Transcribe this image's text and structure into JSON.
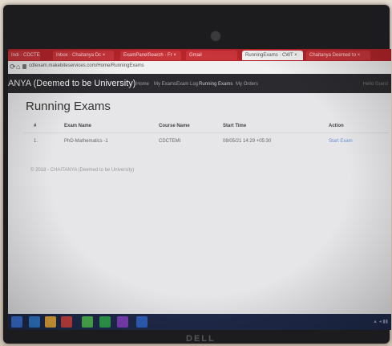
{
  "browser": {
    "tabs": [
      {
        "label": "Indi · CDCTEAM Ch ×"
      },
      {
        "label": "Inbox · Chaitanya Dc ×"
      },
      {
        "label": "ExamPanelSearch · Fr ×"
      },
      {
        "label": "Gmail"
      },
      {
        "label": "RunningExams · CWT ×",
        "active": true
      },
      {
        "label": "Chaitanya Deemed to ×"
      }
    ],
    "url": "cdtexam.makebiteservices.com/Home/RunningExams"
  },
  "site": {
    "title": "ANYA (Deemed to be University)",
    "nav": [
      "Home",
      "My Exams",
      "Exam Log",
      "Running Exams",
      "My Orders"
    ],
    "nav_right": "Hello Guest"
  },
  "page": {
    "title": "Running Exams",
    "table": {
      "headers": [
        "#",
        "Exam Name",
        "Course Name",
        "Start Time",
        "Action"
      ],
      "rows": [
        {
          "num": "1.",
          "exam": "PhD-Mathematics -1",
          "course": "CDCTEMI",
          "start": "08/05/21 14:29 +05:30",
          "action": "Start Exam"
        }
      ]
    },
    "footer": "© 2018 - CHAITANYA (Deemed to be University)"
  },
  "device": {
    "brand": "DELL"
  },
  "colors": {
    "tabbar": "#b5252b",
    "navbar": "#2b2b2f",
    "link": "#6b8fd6",
    "taskbar": "#1f2a4a"
  }
}
